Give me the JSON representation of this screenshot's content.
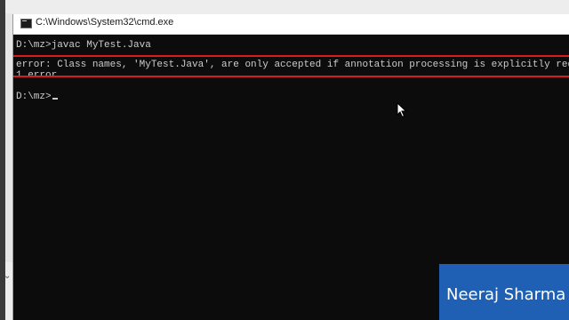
{
  "window": {
    "title": "C:\\Windows\\System32\\cmd.exe",
    "icon": "cmd-icon"
  },
  "console": {
    "lines": [
      "D:\\mz>javac MyTest.Java",
      "error: Class names, 'MyTest.Java', are only accepted if annotation processing is explicitly requested",
      "1 error",
      "",
      "D:\\mz>"
    ]
  },
  "highlight_color": "#d91c1c",
  "watermark": {
    "text": "Neeraj Sharma",
    "background": "#1f5fb4"
  }
}
